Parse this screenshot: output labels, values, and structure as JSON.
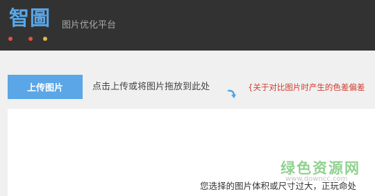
{
  "header": {
    "logo_text": "智圖",
    "subtitle": "图片优化平台",
    "brand_color": "#5aa6e6",
    "dot_colors": [
      "#e0533d",
      "#e0533d",
      "#e6b94a"
    ]
  },
  "toolbar": {
    "upload_label": "上传图片",
    "hint_text": "点击上传或将图片拖放到此处",
    "notice_text": "{关于对比图片时产生的色差偏差",
    "arrow_icon": "curved-arrow-icon"
  },
  "panel": {
    "watermark_text": "绿色资源网",
    "watermark_url": "www.downcc.com",
    "warning_text": "您选择的图片体积或尺寸过大，正玩命处"
  }
}
